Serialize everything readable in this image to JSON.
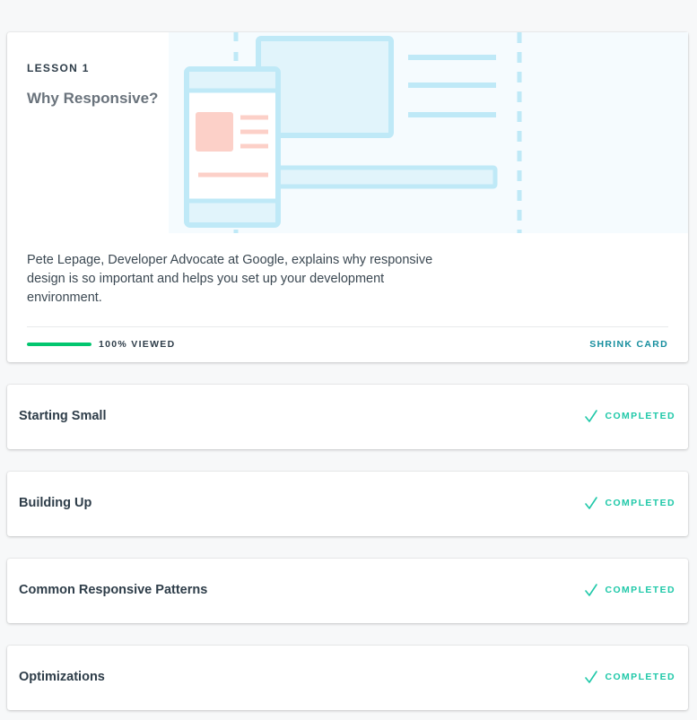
{
  "lesson": {
    "label": "LESSON 1",
    "title": "Why Responsive?",
    "description": "Pete Lepage, Developer Advocate at Google, explains why responsive design is so important and helps you set up your development environment.",
    "progress_percent": 100,
    "progress_label": "100% VIEWED",
    "shrink_label": "SHRINK CARD",
    "illustration_icon": "responsive-devices-illustration"
  },
  "lessons": [
    {
      "title": "Starting Small",
      "status": "COMPLETED"
    },
    {
      "title": "Building Up",
      "status": "COMPLETED"
    },
    {
      "title": "Common Responsive Patterns",
      "status": "COMPLETED"
    },
    {
      "title": "Optimizations",
      "status": "COMPLETED"
    }
  ],
  "colors": {
    "progress": "#02c66f",
    "completed": "#1ec8a8",
    "link": "#168e9e",
    "illustration_blue": "#bfe9f7",
    "illustration_pink": "#fcd0c8"
  }
}
